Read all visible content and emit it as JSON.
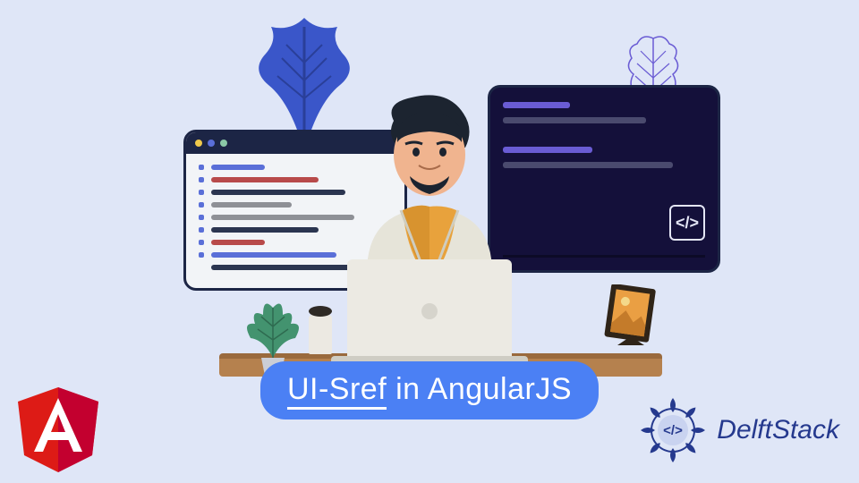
{
  "title": {
    "keyword": "UI-Sref",
    "rest": " in AngularJS"
  },
  "brand": {
    "name": "DelftStack"
  },
  "logos": {
    "angular_letter": "A",
    "code_badge": "</>"
  },
  "colors": {
    "bg": "#dfe6f7",
    "pill": "#4b80f4",
    "dark_window": "#14103a",
    "accent_blue": "#3a56c9",
    "accent_red": "#dd1b16",
    "brand_blue": "#25398e"
  }
}
